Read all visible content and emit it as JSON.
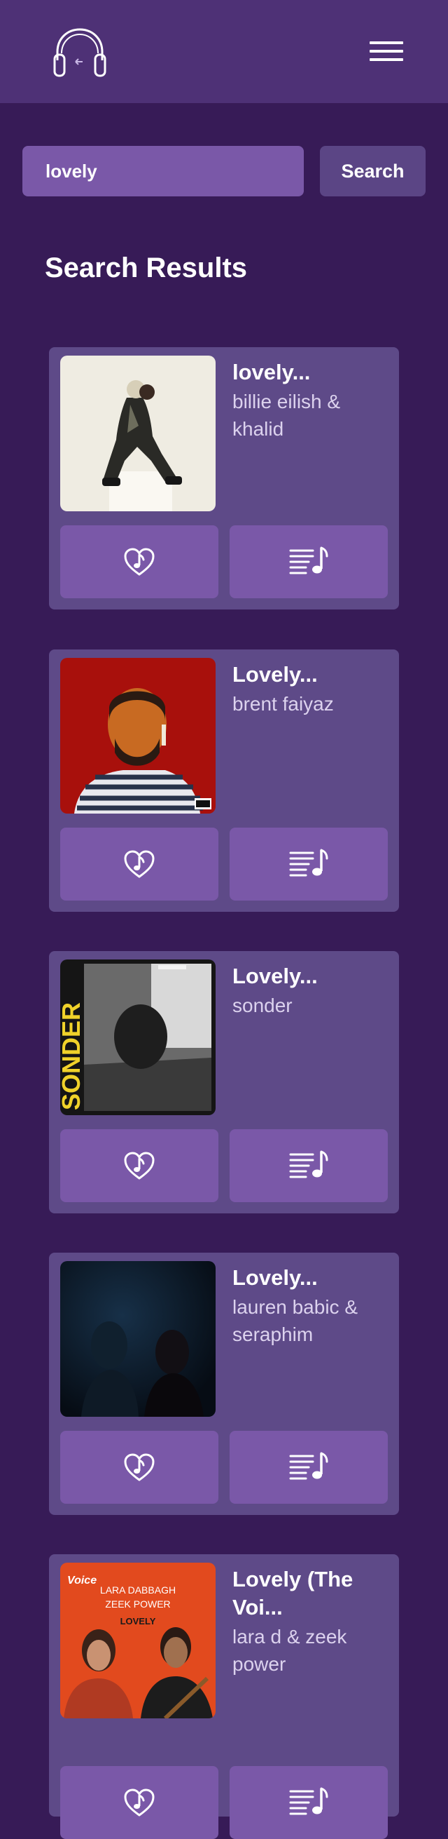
{
  "header": {
    "logo_icon": "headphones-icon",
    "menu_icon": "hamburger-menu-icon"
  },
  "search": {
    "value": "lovely",
    "button_label": "Search"
  },
  "section_title": "Search Results",
  "colors": {
    "background": "#371b57",
    "header": "#4e3176",
    "card": "#5e4a88",
    "button": "#7a58a8",
    "search_button": "#5b4585"
  },
  "results": [
    {
      "title": "lovely...",
      "artist": "billie eilish & khalid",
      "favorite_icon": "heart-music-icon",
      "queue_icon": "playlist-icon"
    },
    {
      "title": "Lovely...",
      "artist": "brent faiyaz",
      "favorite_icon": "heart-music-icon",
      "queue_icon": "playlist-icon"
    },
    {
      "title": "Lovely...",
      "artist": "sonder",
      "cover_text": "SONDER",
      "favorite_icon": "heart-music-icon",
      "queue_icon": "playlist-icon"
    },
    {
      "title": "Lovely...",
      "artist": "lauren babic & seraphim",
      "favorite_icon": "heart-music-icon",
      "queue_icon": "playlist-icon"
    },
    {
      "title": "Lovely (The Voi...",
      "artist": "lara d & zeek power",
      "cover_text": [
        "Voice",
        "LARA DABBAGH",
        "ZEEK POWER",
        "LOVELY"
      ],
      "favorite_icon": "heart-music-icon",
      "queue_icon": "playlist-icon"
    }
  ]
}
